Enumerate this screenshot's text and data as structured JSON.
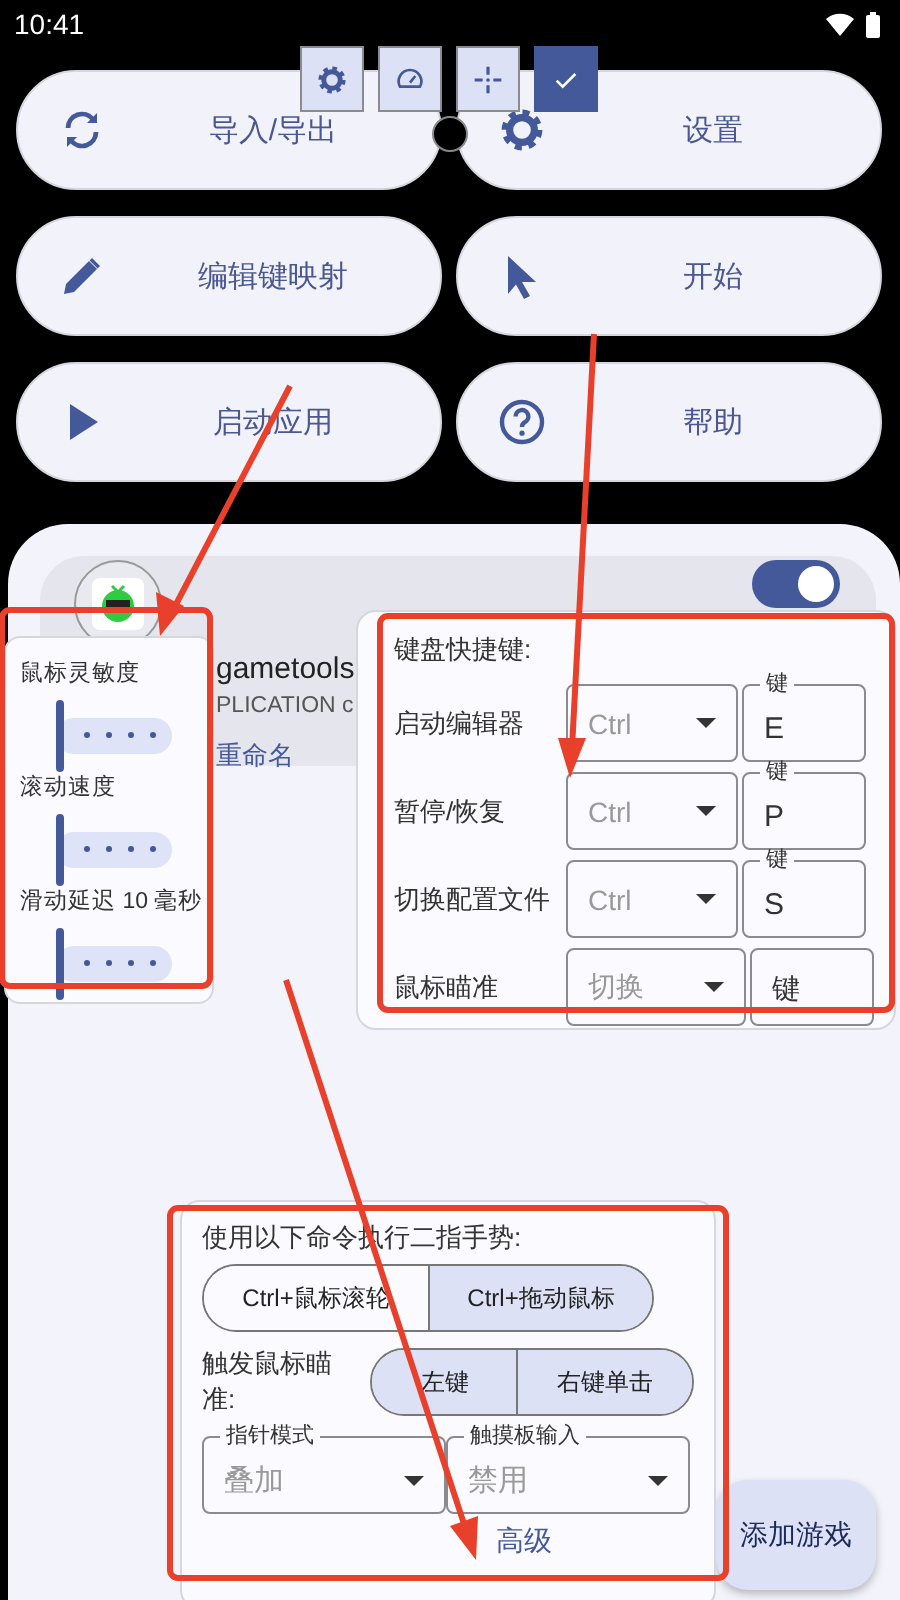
{
  "status_bar": {
    "time": "10:41"
  },
  "toolbar": {
    "items": [
      {
        "kind": "gear",
        "selected": false
      },
      {
        "kind": "gauge",
        "selected": false
      },
      {
        "kind": "move",
        "selected": false
      },
      {
        "kind": "check",
        "selected": true
      }
    ]
  },
  "actions": [
    {
      "kind": "sync",
      "label": "导入/导出"
    },
    {
      "kind": "gear",
      "label": "设置"
    },
    {
      "kind": "pencil",
      "label": "编辑键映射"
    },
    {
      "kind": "cursor",
      "label": "开始"
    },
    {
      "kind": "play",
      "label": "启动应用"
    },
    {
      "kind": "help",
      "label": "帮助"
    }
  ],
  "app_card": {
    "name": "gametools",
    "package": "PLICATION c",
    "rename": "重命名",
    "enabled": true
  },
  "sensitivity_panel": {
    "sliders": [
      {
        "label": "鼠标灵敏度",
        "level": 0
      },
      {
        "label": "滚动速度",
        "level": 0
      },
      {
        "label": "滑动延迟 10 毫秒",
        "level": 0
      }
    ]
  },
  "shortcuts_panel": {
    "title": "键盘快捷键:",
    "rows": [
      {
        "label": "启动编辑器",
        "modifier": "Ctrl",
        "key_label": "键",
        "key": "E"
      },
      {
        "label": "暂停/恢复",
        "modifier": "Ctrl",
        "key_label": "键",
        "key": "P"
      },
      {
        "label": "切换配置文件",
        "modifier": "Ctrl",
        "key_label": "键",
        "key": "S"
      },
      {
        "label": "鼠标瞄准",
        "modifier": "切换",
        "placeholder": "键"
      }
    ]
  },
  "gesture_panel": {
    "title": "使用以下命令执行二指手势:",
    "gesture_options": [
      {
        "label": "Ctrl+鼠标滚轮",
        "selected": false
      },
      {
        "label": "Ctrl+拖动鼠标",
        "selected": true
      }
    ],
    "aim_label": "触发鼠标瞄准:",
    "aim_options": [
      {
        "label": "左键",
        "selected": true
      },
      {
        "label": "右键单击",
        "selected": true
      }
    ],
    "fields": [
      {
        "label": "指针模式",
        "value": "叠加"
      },
      {
        "label": "触摸板输入",
        "value": "禁用"
      }
    ]
  },
  "footer": {
    "advanced": "高级",
    "add_button": "添加游戏"
  }
}
